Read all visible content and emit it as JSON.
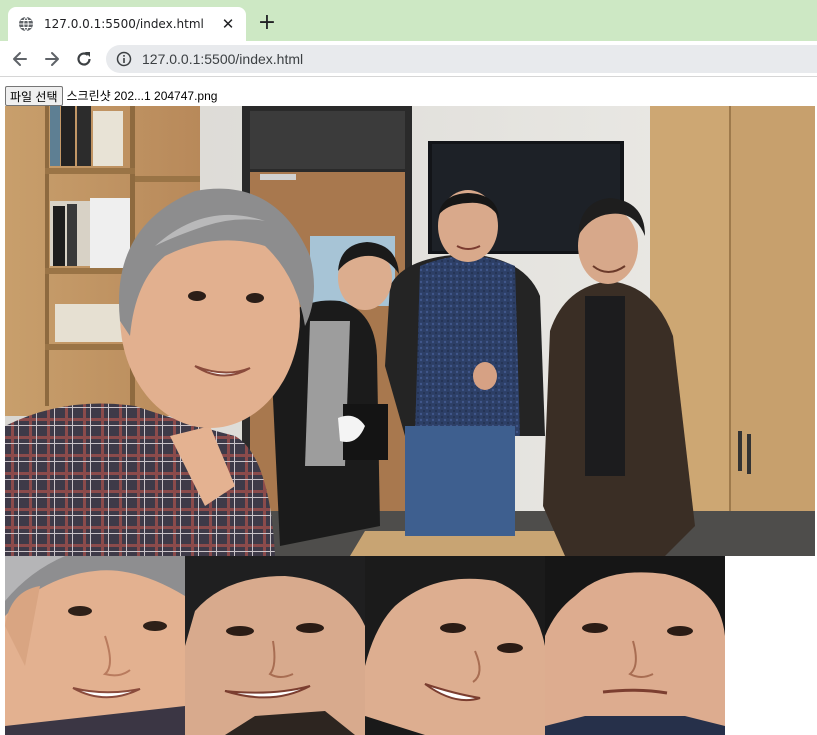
{
  "browser": {
    "tab_title": "127.0.0.1:5500/index.html",
    "tab_icon": "globe-icon",
    "close_icon": "close-icon",
    "new_tab_icon": "plus-icon",
    "url": "127.0.0.1:5500/index.html",
    "info_icon": "info-icon",
    "tabstrip_color": "#cde8c4"
  },
  "page": {
    "file_button_label": "파일 선택",
    "file_name": "스크린샷 202...1 204747.png"
  }
}
